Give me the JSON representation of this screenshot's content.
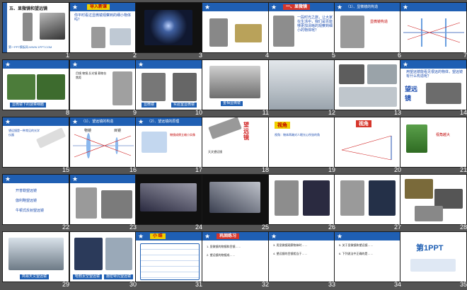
{
  "slides": [
    {
      "num": "1",
      "title": "五、显微镜和望远镜",
      "caption": "第一PPT模板网-WWW.1PPT.COM"
    },
    {
      "num": "2",
      "title": "导入新课"
    },
    {
      "num": "3"
    },
    {
      "num": "4"
    },
    {
      "num": "5",
      "title": "一、显微镜",
      "text": "一段时光之旅，让大家在生活中，我们是否能够更加清晰的观察到细小的物体呢？"
    },
    {
      "num": "6",
      "title": "（1）、显微镜的构造",
      "label": "显微镜构造"
    },
    {
      "num": "7"
    },
    {
      "num": "8",
      "caption": "显微镜下的菠菜细胞"
    },
    {
      "num": "9"
    },
    {
      "num": "10",
      "caption_a": "显微镜",
      "caption_b": "实验室显微镜"
    },
    {
      "num": "11",
      "caption": "金相显微镜"
    },
    {
      "num": "12"
    },
    {
      "num": "13"
    },
    {
      "num": "14",
      "title": "二、望远镜",
      "text": "用望远镜能看见很远的物体，望远镜有什么构造呢？",
      "label": "望远镜"
    },
    {
      "num": "15"
    },
    {
      "num": "16",
      "title": "（1）、望远镜的构造",
      "label_a": "物镜",
      "label_b": "目镜"
    },
    {
      "num": "17",
      "title": "（2）、望远镜的原理"
    },
    {
      "num": "18",
      "label": "望远镜"
    },
    {
      "num": "19",
      "title": "视角"
    },
    {
      "num": "20",
      "title": "视角"
    },
    {
      "num": "21",
      "text": "视角越大"
    },
    {
      "num": "22",
      "items": [
        "开普勒望远镜",
        "伽利略望远镜",
        "牛顿式反射望远镜"
      ]
    },
    {
      "num": "23"
    },
    {
      "num": "24"
    },
    {
      "num": "25"
    },
    {
      "num": "26"
    },
    {
      "num": "27"
    },
    {
      "num": "28"
    },
    {
      "num": "29",
      "caption": "简易天文望远镜"
    },
    {
      "num": "30",
      "caption_a": "哈勃太空望远镜",
      "caption_b": "施密特式望远镜"
    },
    {
      "num": "31",
      "title": "小 结"
    },
    {
      "num": "32",
      "title": "巩固练习"
    },
    {
      "num": "33"
    },
    {
      "num": "34"
    },
    {
      "num": "35",
      "logo": "第1PPT"
    }
  ]
}
